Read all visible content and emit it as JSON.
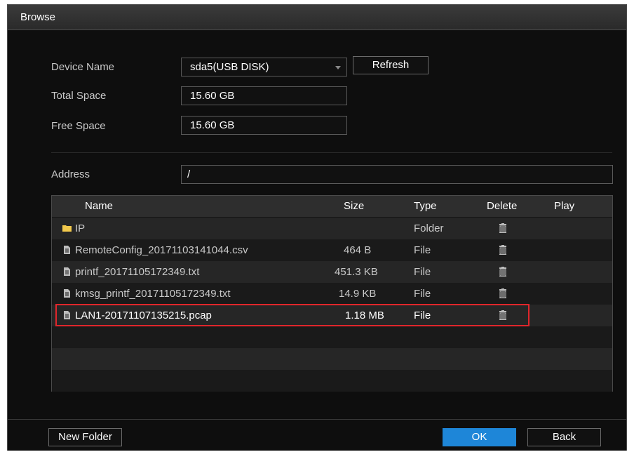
{
  "dialog": {
    "title": "Browse"
  },
  "device": {
    "label": "Device Name",
    "value": "sda5(USB DISK)",
    "refresh_label": "Refresh"
  },
  "total_space": {
    "label": "Total Space",
    "value": "15.60 GB"
  },
  "free_space": {
    "label": "Free Space",
    "value": "15.60 GB"
  },
  "address": {
    "label": "Address",
    "value": "/"
  },
  "table": {
    "headers": {
      "name": "Name",
      "size": "Size",
      "type": "Type",
      "delete": "Delete",
      "play": "Play"
    },
    "rows": [
      {
        "icon": "folder-icon",
        "name": "IP",
        "size": "",
        "type": "Folder"
      },
      {
        "icon": "file-icon",
        "name": "RemoteConfig_20171103141044.csv",
        "size": "464 B",
        "type": "File"
      },
      {
        "icon": "file-icon",
        "name": "printf_20171105172349.txt",
        "size": "451.3 KB",
        "type": "File"
      },
      {
        "icon": "file-icon",
        "name": "kmsg_printf_20171105172349.txt",
        "size": "14.9 KB",
        "type": "File"
      },
      {
        "icon": "file-icon",
        "name": "LAN1-20171107135215.pcap",
        "size": "1.18 MB",
        "type": "File"
      }
    ]
  },
  "buttons": {
    "new_folder": "New Folder",
    "ok": "OK",
    "back": "Back"
  },
  "colors": {
    "accent": "#1e86d8",
    "highlight": "#e0262b",
    "folder": "#f2c94c"
  }
}
